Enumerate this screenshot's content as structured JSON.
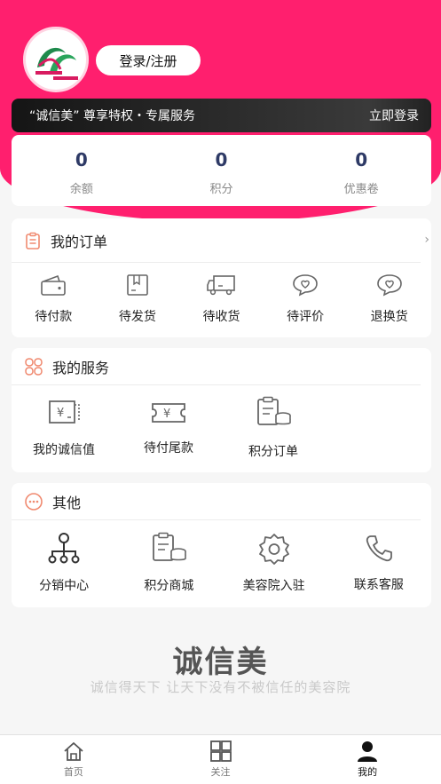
{
  "header": {
    "login_label": "登录/注册",
    "vip_text": "“诚信美” 尊享特权・专属服务",
    "vip_action": "立即登录",
    "brand_color": "#ff1f6e"
  },
  "stats": [
    {
      "value": "0",
      "label": "余额"
    },
    {
      "value": "0",
      "label": "积分"
    },
    {
      "value": "0",
      "label": "优惠卷"
    }
  ],
  "orders": {
    "title": "我的订单",
    "items": [
      {
        "label": "待付款",
        "icon": "wallet-icon"
      },
      {
        "label": "待发货",
        "icon": "box-icon"
      },
      {
        "label": "待收货",
        "icon": "truck-icon"
      },
      {
        "label": "待评价",
        "icon": "heart-chat-icon"
      },
      {
        "label": "退换货",
        "icon": "heart-chat-icon"
      }
    ]
  },
  "services": {
    "title": "我的服务",
    "items": [
      {
        "label": "我的诚信值",
        "icon": "credit-receipt-icon"
      },
      {
        "label": "待付尾款",
        "icon": "ticket-icon"
      },
      {
        "label": "积分订单",
        "icon": "points-list-icon"
      }
    ]
  },
  "other": {
    "title": "其他",
    "items": [
      {
        "label": "分销中心",
        "icon": "network-icon"
      },
      {
        "label": "积分商城",
        "icon": "points-list-icon"
      },
      {
        "label": "美容院入驻",
        "icon": "gear-icon"
      },
      {
        "label": "联系客服",
        "icon": "phone-icon"
      }
    ]
  },
  "footer": {
    "logo_text": "诚信美",
    "slogan": "诚信得天下 让天下没有不被信任的美容院"
  },
  "tabbar": [
    {
      "label": "首页",
      "icon": "home-icon"
    },
    {
      "label": "关注",
      "icon": "grid-icon"
    },
    {
      "label": "我的",
      "icon": "user-icon",
      "active": true
    }
  ]
}
